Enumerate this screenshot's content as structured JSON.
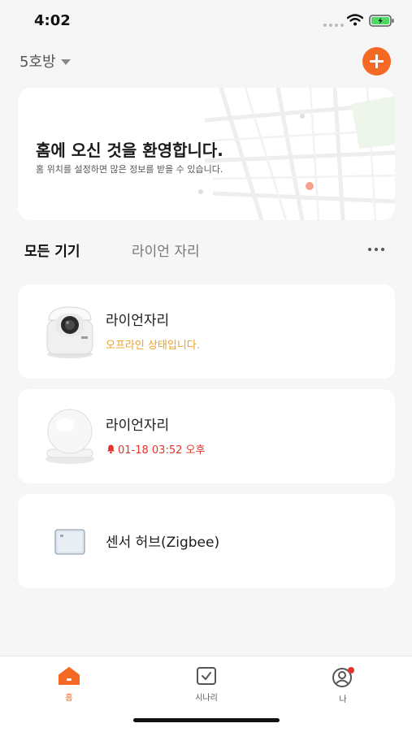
{
  "status_bar": {
    "time": "4:02"
  },
  "header": {
    "home_name": "5호방"
  },
  "welcome": {
    "title": "홈에 오신 것을 환영합니다.",
    "subtitle": "홈 위치를 설정하면 많은 정보를 받을 수 있습니다."
  },
  "tabs": [
    {
      "label": "모든 기기",
      "active": true
    },
    {
      "label": "라이언 자리",
      "active": false
    }
  ],
  "devices": [
    {
      "name": "라이언자리",
      "status": "오프라인 상태입니다.",
      "icon": "camera-icon"
    },
    {
      "name": "라이언자리",
      "status": "01-18 03:52 오후",
      "icon": "motion-sensor-icon"
    },
    {
      "name": "센서 허브(Zigbee)",
      "status": "",
      "icon": "hub-icon"
    }
  ],
  "tab_bar": [
    {
      "label": "홈",
      "icon": "home-icon"
    },
    {
      "label": "시나리",
      "icon": "scene-icon"
    },
    {
      "label": "나",
      "icon": "profile-icon"
    }
  ],
  "colors": {
    "accent": "#f46a25",
    "offline": "#f0a020",
    "alert": "#e3342f",
    "background": "#f6f6f6"
  }
}
